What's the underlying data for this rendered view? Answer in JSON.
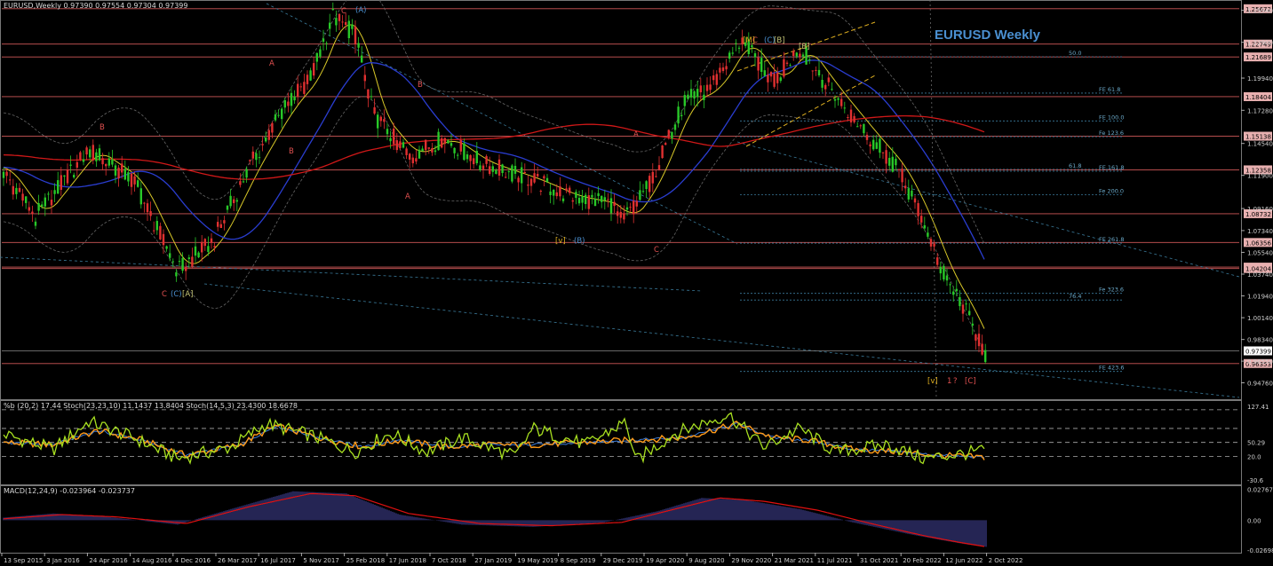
{
  "header": {
    "main": "EURUSD,Weekly  0.97390 0.97554 0.97304 0.97399",
    "stoch": "%b (20,2) 17.44  Stoch(23,23,10) 11.1437 13.8404  Stoch(14,5,3) 23.4300 18.6678",
    "macd": "MACD(12,24,9) -0.023964 -0.023737"
  },
  "chart_title": "EURUSD Weekly",
  "colors": {
    "bg": "#000000",
    "bull": "#28c828",
    "bear": "#e03030",
    "ma_red": "#d01818",
    "ma_blue": "#2a3dd0",
    "ma_yellow": "#d8c828",
    "level": "#d05858",
    "grid_dot": "#3a7a9a",
    "stoch_green": "#a8e020",
    "stoch_orange": "#ff9a18",
    "macd_hist": "#4a4aa8",
    "macd_signal": "#e01010"
  },
  "chart_data": {
    "type": "line",
    "ylim": [
      0.9355,
      1.261
    ],
    "price_ticks": [
      "1.25540",
      "1.22900",
      "1.19940",
      "1.17280",
      "1.14540",
      "1.11900",
      "1.09160",
      "1.07340",
      "1.05540",
      "1.03740",
      "1.01940",
      "1.00140",
      "0.98340",
      "0.96550",
      "0.94760"
    ],
    "level_labels": [
      "1.25672",
      "1.22749",
      "1.21689",
      "1.18404",
      "1.15138",
      "1.12358",
      "1.08732",
      "1.06356",
      "1.04320",
      "1.04204",
      "0.96353"
    ],
    "level_values": [
      1.25672,
      1.22749,
      1.21689,
      1.18404,
      1.15138,
      1.12358,
      1.08732,
      1.06356,
      1.0432,
      1.04204,
      0.96353
    ],
    "current_price": "0.97399",
    "current_value": 0.97399,
    "fib_labels": [
      "50.0",
      "FE 61.8",
      "FE 100.0",
      "Fe 123.6",
      "61.8",
      "FE 161.8",
      "Fe 200.0",
      "FE 261.8",
      "Fe 323.6",
      "76.4",
      "FE 423.6"
    ],
    "fib_values": [
      1.217,
      1.187,
      1.164,
      1.151,
      1.124,
      1.1225,
      1.103,
      1.063,
      1.0215,
      1.016,
      0.957
    ],
    "x_labels": [
      "13 Sep 2015",
      "3 Jan 2016",
      "24 Apr 2016",
      "14 Aug 2016",
      "4 Dec 2016",
      "26 Mar 2017",
      "16 Jul 2017",
      "5 Nov 2017",
      "25 Feb 2018",
      "17 Jun 2018",
      "7 Oct 2018",
      "27 Jan 2019",
      "19 May 2019",
      "8 Sep 2019",
      "29 Dec 2019",
      "19 Apr 2020",
      "9 Aug 2020",
      "29 Nov 2020",
      "21 Mar 2021",
      "11 Jul 2021",
      "31 Oct 2021",
      "20 Feb 2022",
      "12 Jun 2022",
      "2 Oct 2022"
    ],
    "price_path": [
      [
        0,
        1.126
      ],
      [
        40,
        1.085
      ],
      [
        100,
        1.14
      ],
      [
        150,
        1.115
      ],
      [
        200,
        1.04
      ],
      [
        240,
        1.065
      ],
      [
        280,
        1.125
      ],
      [
        320,
        1.175
      ],
      [
        350,
        1.2
      ],
      [
        375,
        1.25
      ],
      [
        400,
        1.235
      ],
      [
        420,
        1.17
      ],
      [
        460,
        1.135
      ],
      [
        500,
        1.15
      ],
      [
        540,
        1.13
      ],
      [
        600,
        1.115
      ],
      [
        640,
        1.102
      ],
      [
        690,
        1.095
      ],
      [
        700,
        1.08
      ],
      [
        730,
        1.11
      ],
      [
        770,
        1.18
      ],
      [
        800,
        1.19
      ],
      [
        835,
        1.232
      ],
      [
        870,
        1.195
      ],
      [
        900,
        1.225
      ],
      [
        935,
        1.19
      ],
      [
        980,
        1.15
      ],
      [
        1010,
        1.125
      ],
      [
        1040,
        1.08
      ],
      [
        1060,
        1.04
      ],
      [
        1085,
        1.01
      ],
      [
        1110,
        0.97
      ]
    ],
    "wave_labels": [
      "C",
      "(A)",
      "A",
      "B",
      "A",
      "B",
      "C",
      "(C)",
      "[A]",
      "[B]",
      "C",
      "(B)",
      "[v]",
      "A",
      "B",
      "C",
      "(C)",
      "[B]",
      "[M]",
      "[C]",
      "[v]",
      "1",
      "?"
    ],
    "stoch_ticks": [
      "127.41",
      "50.29",
      "20.0",
      "-30.6"
    ],
    "stoch_ylim": [
      -38,
      135
    ],
    "stoch_levels": [
      120,
      80,
      50,
      20
    ],
    "stoch_fast": [
      [
        0,
        70
      ],
      [
        60,
        35
      ],
      [
        100,
        95
      ],
      [
        150,
        60
      ],
      [
        200,
        15
      ],
      [
        260,
        40
      ],
      [
        300,
        90
      ],
      [
        350,
        65
      ],
      [
        400,
        30
      ],
      [
        440,
        70
      ],
      [
        480,
        30
      ],
      [
        520,
        60
      ],
      [
        580,
        20
      ],
      [
        600,
        80
      ],
      [
        660,
        45
      ],
      [
        705,
        95
      ],
      [
        715,
        10
      ],
      [
        760,
        70
      ],
      [
        820,
        110
      ],
      [
        860,
        40
      ],
      [
        900,
        80
      ],
      [
        940,
        30
      ],
      [
        1000,
        45
      ],
      [
        1040,
        15
      ],
      [
        1080,
        25
      ],
      [
        1110,
        33
      ]
    ],
    "stoch_slow": [
      [
        0,
        50
      ],
      [
        60,
        45
      ],
      [
        110,
        75
      ],
      [
        160,
        55
      ],
      [
        210,
        22
      ],
      [
        270,
        45
      ],
      [
        310,
        85
      ],
      [
        360,
        60
      ],
      [
        410,
        40
      ],
      [
        450,
        55
      ],
      [
        500,
        40
      ],
      [
        550,
        45
      ],
      [
        600,
        45
      ],
      [
        660,
        50
      ],
      [
        710,
        55
      ],
      [
        770,
        60
      ],
      [
        830,
        90
      ],
      [
        870,
        60
      ],
      [
        910,
        55
      ],
      [
        960,
        35
      ],
      [
        1010,
        30
      ],
      [
        1060,
        22
      ],
      [
        1110,
        18
      ]
    ],
    "macd_ticks": [
      "0.027679",
      "0.00",
      "-0.026984"
    ],
    "macd_ylim": [
      -0.0285,
      0.029
    ],
    "macd_hist": [
      [
        0,
        0.002
      ],
      [
        60,
        0.006
      ],
      [
        120,
        0.003
      ],
      [
        200,
        -0.004
      ],
      [
        260,
        0.01
      ],
      [
        330,
        0.026
      ],
      [
        390,
        0.024
      ],
      [
        450,
        0.005
      ],
      [
        520,
        -0.004
      ],
      [
        600,
        -0.006
      ],
      [
        680,
        -0.002
      ],
      [
        740,
        0.008
      ],
      [
        790,
        0.02
      ],
      [
        840,
        0.018
      ],
      [
        900,
        0.01
      ],
      [
        960,
        -0.002
      ],
      [
        1020,
        -0.012
      ],
      [
        1060,
        -0.018
      ],
      [
        1090,
        -0.022
      ],
      [
        1110,
        -0.024
      ]
    ],
    "macd_signal": [
      [
        0,
        0.001
      ],
      [
        70,
        0.005
      ],
      [
        130,
        0.003
      ],
      [
        210,
        -0.003
      ],
      [
        280,
        0.012
      ],
      [
        350,
        0.024
      ],
      [
        400,
        0.022
      ],
      [
        460,
        0.006
      ],
      [
        540,
        -0.003
      ],
      [
        620,
        -0.005
      ],
      [
        700,
        -0.002
      ],
      [
        760,
        0.01
      ],
      [
        810,
        0.02
      ],
      [
        860,
        0.017
      ],
      [
        920,
        0.009
      ],
      [
        980,
        -0.003
      ],
      [
        1040,
        -0.014
      ],
      [
        1080,
        -0.02
      ],
      [
        1110,
        -0.024
      ]
    ]
  }
}
